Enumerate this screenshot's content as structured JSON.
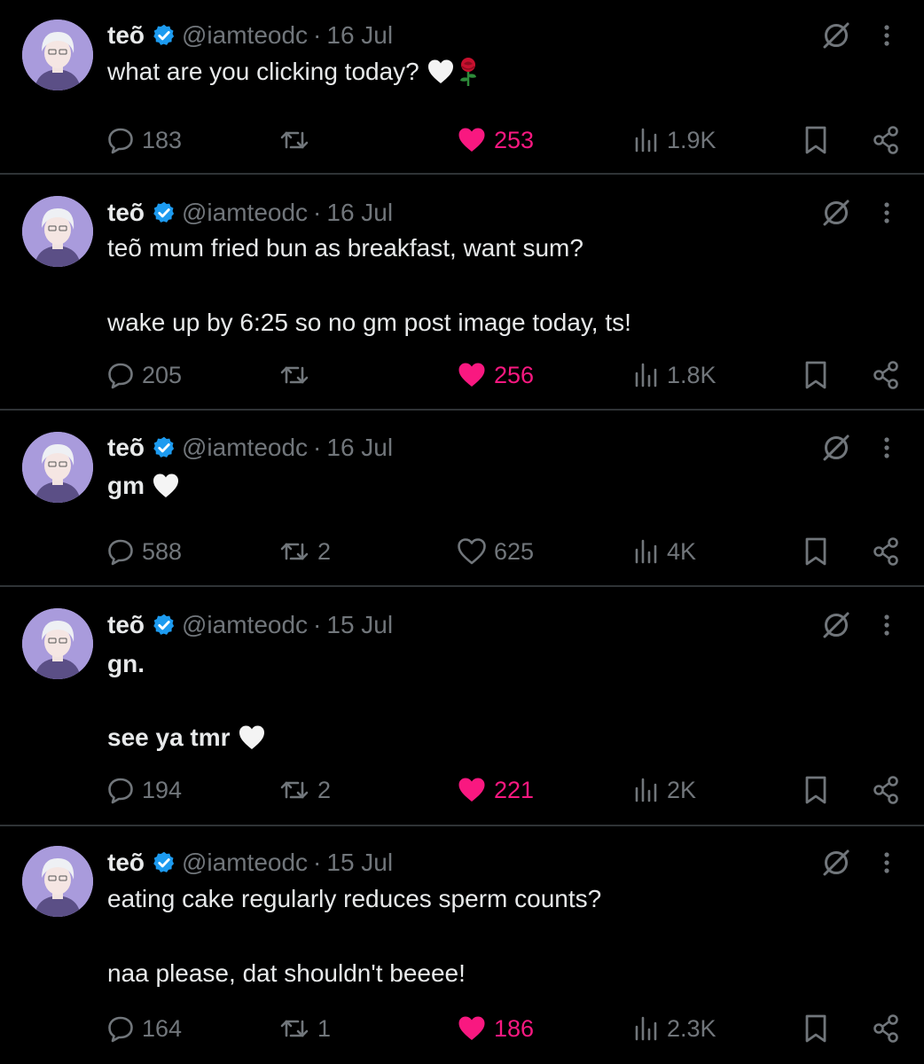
{
  "tweets": [
    {
      "name": "teõ",
      "handle": "@iamteodc",
      "date": "16 Jul",
      "lines": [
        "what are you clicking today?"
      ],
      "emojis": [
        "white-heart",
        "rose"
      ],
      "stats": {
        "replies": "183",
        "reposts": "",
        "likes": "253",
        "views": "1.9K"
      },
      "liked": true
    },
    {
      "name": "teõ",
      "handle": "@iamteodc",
      "date": "16 Jul",
      "lines": [
        "teõ mum fried bun as breakfast, want sum?",
        "wake up by 6:25 so no gm post image today, ts!"
      ],
      "stats": {
        "replies": "205",
        "reposts": "",
        "likes": "256",
        "views": "1.8K"
      },
      "liked": true
    },
    {
      "name": "teõ",
      "handle": "@iamteodc",
      "date": "16 Jul",
      "lines": [
        "gm"
      ],
      "emojis": [
        "white-heart"
      ],
      "stats": {
        "replies": "588",
        "reposts": "2",
        "likes": "625",
        "views": "4K"
      },
      "liked": false
    },
    {
      "name": "teõ",
      "handle": "@iamteodc",
      "date": "15 Jul",
      "lines": [
        "gn.",
        "see ya tmr"
      ],
      "emojis": [
        "white-heart"
      ],
      "stats": {
        "replies": "194",
        "reposts": "2",
        "likes": "221",
        "views": "2K"
      },
      "liked": true
    },
    {
      "name": "teõ",
      "handle": "@iamteodc",
      "date": "15 Jul",
      "lines": [
        "eating cake regularly reduces sperm counts?",
        "naa please, dat shouldn't beeee!"
      ],
      "stats": {
        "replies": "164",
        "reposts": "1",
        "likes": "186",
        "views": "2.3K"
      },
      "liked": true
    }
  ],
  "separator": "·",
  "colors": {
    "background": "#000000",
    "text": "#e7e9ea",
    "muted": "#71767b",
    "like": "#f91880",
    "verified": "#1d9bf0",
    "divider": "#2f3336"
  },
  "icons": [
    "verified-badge-icon",
    "grok-icon",
    "more-icon",
    "reply-icon",
    "repost-icon",
    "like-icon",
    "views-icon",
    "bookmark-icon",
    "share-icon"
  ]
}
